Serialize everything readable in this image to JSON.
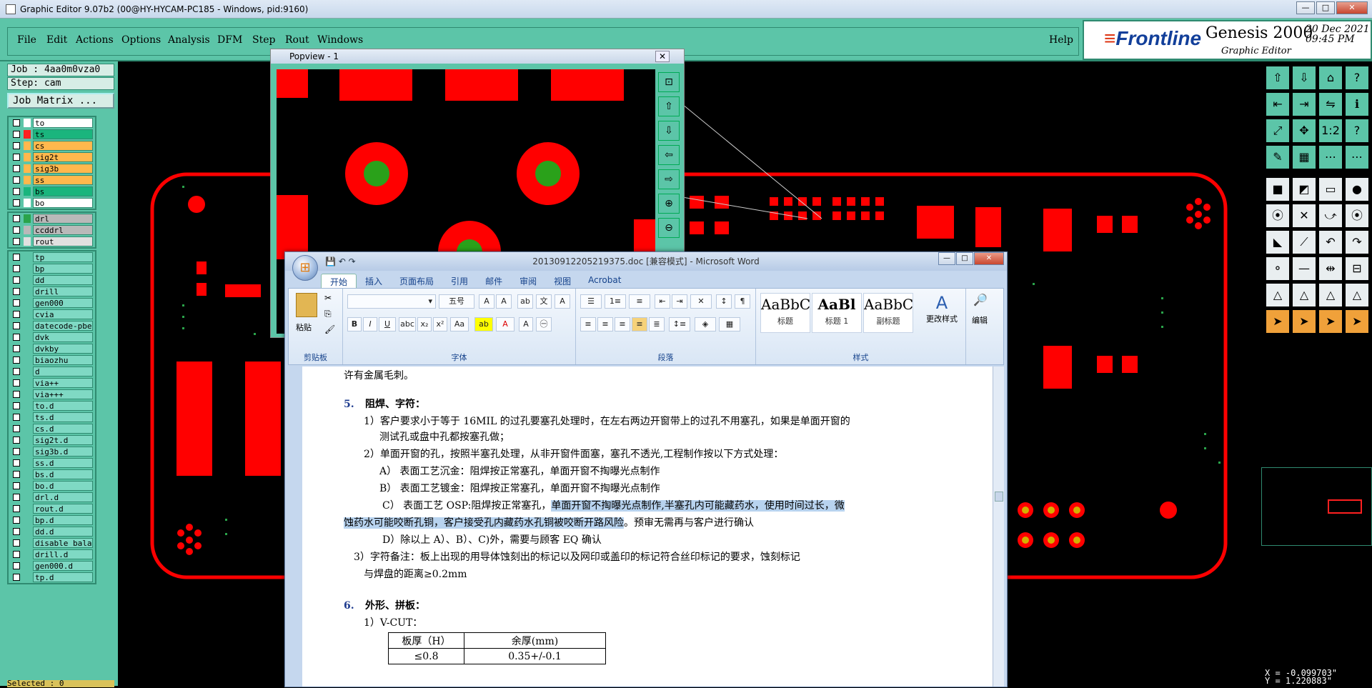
{
  "titlebar": {
    "title": "Graphic Editor 9.07b2 (00@HY-HYCAM-PC185 - Windows, pid:9160)"
  },
  "menu": {
    "items": [
      "File",
      "Edit",
      "Actions",
      "Options",
      "Analysis",
      "DFM",
      "Step",
      "Rout",
      "Windows"
    ],
    "help": "Help"
  },
  "brand": {
    "name": "Frontline",
    "product": "Genesis 2000",
    "module": "Graphic Editor",
    "date": "20 Dec 2021",
    "time": "09:45 PM"
  },
  "job": {
    "job_line": "Job : 4aa0m0vza0",
    "step_line": "Step: cam",
    "matrix_button": "Job Matrix ..."
  },
  "layers_board": [
    {
      "name": "to",
      "color": "#ffffff",
      "bg": "#ffffff"
    },
    {
      "name": "ts",
      "color": "#ff2020",
      "bg": "#1ab57d"
    },
    {
      "name": "cs",
      "color": "#ffb84d",
      "bg": "#ffb84d"
    },
    {
      "name": "sig2t",
      "color": "#ffb84d",
      "bg": "#ffb84d"
    },
    {
      "name": "sig3b",
      "color": "#ffb84d",
      "bg": "#ffb84d"
    },
    {
      "name": "ss",
      "color": "#ffb84d",
      "bg": "#ffb84d"
    },
    {
      "name": "bs",
      "color": "#1ab57d",
      "bg": "#1ab57d"
    },
    {
      "name": "bo",
      "color": "#ffffff",
      "bg": "#ffffff"
    }
  ],
  "layers_drill": [
    {
      "name": "drl",
      "color": "#2aa34a",
      "bg": "#b9b9b9"
    },
    {
      "name": "ccddrl",
      "color": "#b9b9b9",
      "bg": "#b9b9b9"
    },
    {
      "name": "rout",
      "color": "#e0e0e0",
      "bg": "#e0e0e0"
    }
  ],
  "layers_misc": [
    "tp",
    "bp",
    "dd",
    "drill",
    "gen000",
    "cvia",
    "datecode-pbe",
    "dvk",
    "dvkby",
    "biaozhu",
    "d",
    "via++",
    "via+++",
    "to.d",
    "ts.d",
    "cs.d",
    "sig2t.d",
    "sig3b.d",
    "ss.d",
    "bs.d",
    "bo.d",
    "drl.d",
    "rout.d",
    "bp.d",
    "dd.d",
    "disable_bala",
    "drill.d",
    "gen000.d",
    "tp.d"
  ],
  "selected": "Selected : 0",
  "coords": {
    "x": "X = -0.099703\"",
    "y": "Y = 1.220883\""
  },
  "popview": {
    "title": "Popview - 1"
  },
  "word": {
    "title": "20130912205219375.doc [兼容模式] - Microsoft Word",
    "tabs": [
      "开始",
      "插入",
      "页面布局",
      "引用",
      "邮件",
      "审阅",
      "视图",
      "Acrobat"
    ],
    "groups": [
      "剪贴板",
      "字体",
      "段落",
      "样式",
      "编辑"
    ],
    "paste": "粘贴",
    "font_size": "五号",
    "styles": [
      {
        "sample": "AaBbC",
        "name": "标题"
      },
      {
        "sample": "AaBl",
        "name": "标题 1"
      },
      {
        "sample": "AaBbC",
        "name": "副标题"
      }
    ],
    "change_styles": "更改样式",
    "edit": "编辑",
    "lines": [
      "许有金属毛刺。",
      "5.",
      "阻焊、字符：",
      "1）客户要求小于等于 16MIL 的过孔要塞孔处理时，在左右两边开窗带上的过孔不用塞孔，如果是单面开窗的",
      "测试孔或盘中孔都按塞孔做；",
      "2）单面开窗的孔，按照半塞孔处理，从非开窗件面塞，塞孔不透光,工程制作按以下方式处理：",
      "A） 表面工艺沉金：阻焊按正常塞孔，单面开窗不掏曝光点制作",
      "B） 表面工艺镀金：阻焊按正常塞孔，单面开窗不掏曝光点制作",
      "C） 表面工艺 OSP:阻焊按正常塞孔，",
      "单面开窗不掏曝光点制作,半塞孔内可能藏药水，使用时间过长，微",
      "蚀药水可能咬断孔铜，客户接受孔内藏药水孔铜被咬断开路风险",
      "。预审无需再与客户进行确认",
      "D）除以上 A）、B）、C)外，需要与顾客 EQ 确认",
      "3）字符备注：板上出现的用导体蚀刻出的标记以及网印或盖印的标记符合丝印标记的要求，蚀刻标记",
      "与焊盘的距离≥0.2mm",
      "6.",
      "外形、拼板：",
      "1）V-CUT："
    ],
    "table": [
      [
        "板厚（H）",
        "余厚(mm)"
      ],
      [
        "≤0.8",
        "0.35+/-0.1"
      ]
    ]
  },
  "colors": {
    "pad": "#ff0000",
    "hole": "#2aa11a",
    "canvas": "#000000",
    "panel": "#5cc5a8",
    "dot": "#2aa34a"
  }
}
